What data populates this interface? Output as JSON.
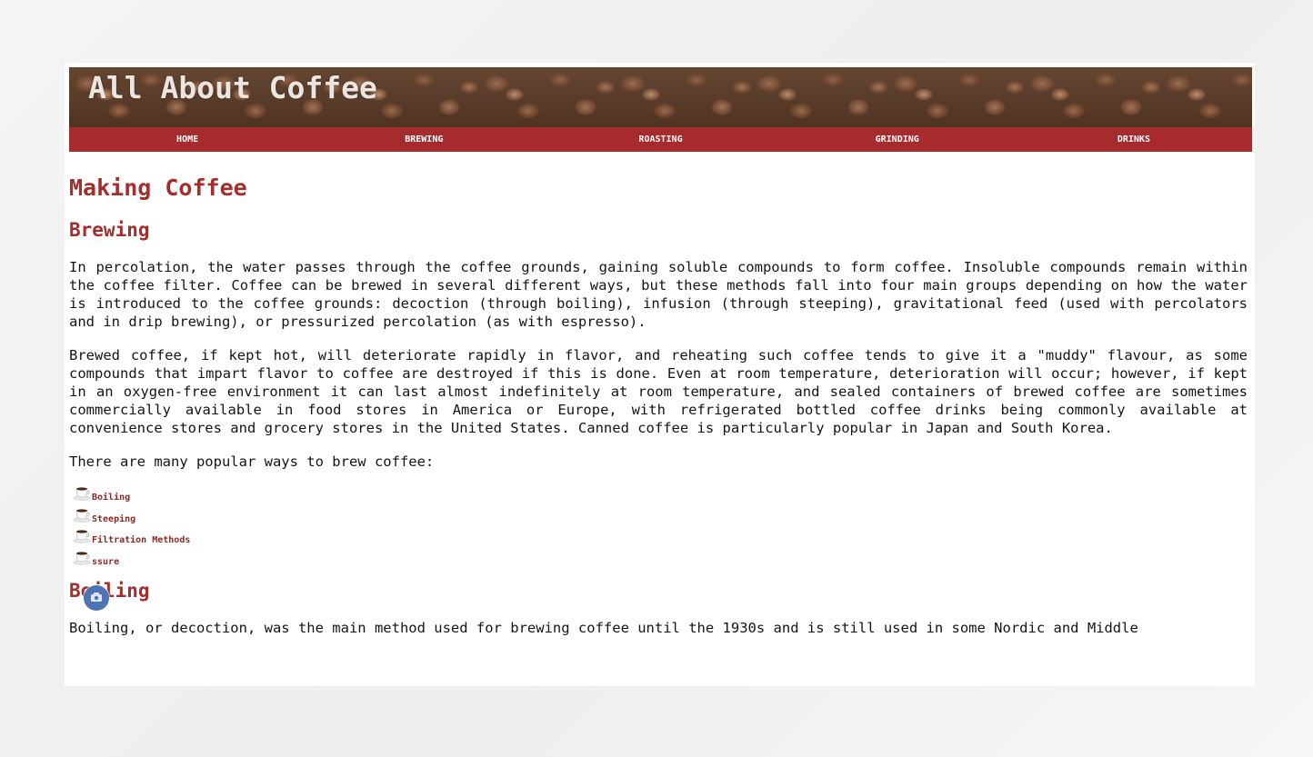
{
  "site": {
    "title": "All About Coffee"
  },
  "nav": [
    {
      "label": "HOME"
    },
    {
      "label": "BREWING"
    },
    {
      "label": "ROASTING"
    },
    {
      "label": "GRINDING"
    },
    {
      "label": "DRINKS"
    }
  ],
  "main": {
    "title": "Making Coffee",
    "brewing": {
      "heading": "Brewing",
      "paragraphs": [
        "In percolation, the water passes through the coffee grounds, gaining soluble compounds to form coffee. Insoluble compounds remain within the coffee filter. Coffee can be brewed in several different ways, but these methods fall into four main groups depending on how the water is introduced to the coffee grounds: decoction (through boiling), infusion (through steeping), gravitational feed (used with percolators and in drip brewing), or pressurized percolation (as with espresso).",
        "Brewed coffee, if kept hot, will deteriorate rapidly in flavor, and reheating such coffee tends to give it a \"muddy\" flavour, as some compounds that impart flavor to coffee are destroyed if this is done. Even at room temperature, deterioration will occur; however, if kept in an oxygen-free environment it can last almost indefinitely at room temperature, and sealed containers of brewed coffee are sometimes commercially available in food stores in America or Europe, with refrigerated bottled coffee drinks being commonly available at convenience stores and grocery stores in the United States. Canned coffee is particularly popular in Japan and South Korea.",
        "There are many popular ways to brew coffee:"
      ],
      "methods": [
        {
          "label": "Boiling",
          "icon": "coffee-cup-icon"
        },
        {
          "label": "Steeping",
          "icon": "coffee-cup-icon"
        },
        {
          "label": "Filtration Methods",
          "icon": "coffee-cup-icon"
        },
        {
          "label": "ssure",
          "icon": "coffee-cup-icon"
        }
      ]
    },
    "boiling": {
      "heading": "Boiling",
      "paragraph": "Boiling, or decoction, was the main method used for brewing coffee until the 1930s and is still used in some Nordic and Middle"
    }
  },
  "colors": {
    "accent": "#a62b2d",
    "heading": "#a32e2d",
    "link": "#8a2a28",
    "text": "#151515"
  }
}
